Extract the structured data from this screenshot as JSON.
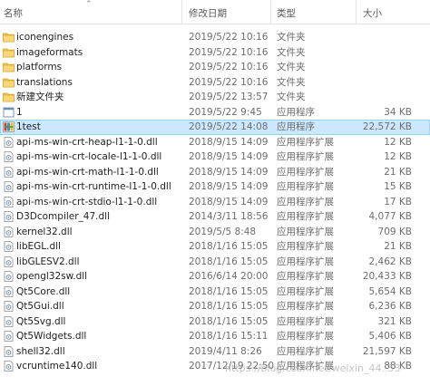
{
  "columns": {
    "name": "名称",
    "modified": "修改日期",
    "type": "类型",
    "size": "大小"
  },
  "files": [
    {
      "name": "iconengines",
      "modified": "2019/5/22 10:16",
      "type": "文件夹",
      "size": "",
      "icon": "folder-icon"
    },
    {
      "name": "imageformats",
      "modified": "2019/5/22 10:16",
      "type": "文件夹",
      "size": "",
      "icon": "folder-icon"
    },
    {
      "name": "platforms",
      "modified": "2019/5/22 10:16",
      "type": "文件夹",
      "size": "",
      "icon": "folder-icon"
    },
    {
      "name": "translations",
      "modified": "2019/5/22 10:16",
      "type": "文件夹",
      "size": "",
      "icon": "folder-icon"
    },
    {
      "name": "新建文件夹",
      "modified": "2019/5/22 13:57",
      "type": "文件夹",
      "size": "",
      "icon": "folder-icon"
    },
    {
      "name": "1",
      "modified": "2019/5/22 9:45",
      "type": "应用程序",
      "size": "34 KB",
      "icon": "app-icon"
    },
    {
      "name": "1test",
      "modified": "2019/5/22 14:08",
      "type": "应用程序",
      "size": "22,572 KB",
      "icon": "qt-app-icon",
      "selected": true
    },
    {
      "name": "api-ms-win-crt-heap-l1-1-0.dll",
      "modified": "2018/9/15 14:09",
      "type": "应用程序扩展",
      "size": "12 KB",
      "icon": "dll-icon"
    },
    {
      "name": "api-ms-win-crt-locale-l1-1-0.dll",
      "modified": "2018/9/15 14:09",
      "type": "应用程序扩展",
      "size": "12 KB",
      "icon": "dll-icon"
    },
    {
      "name": "api-ms-win-crt-math-l1-1-0.dll",
      "modified": "2018/9/15 14:09",
      "type": "应用程序扩展",
      "size": "21 KB",
      "icon": "dll-icon"
    },
    {
      "name": "api-ms-win-crt-runtime-l1-1-0.dll",
      "modified": "2018/9/15 14:09",
      "type": "应用程序扩展",
      "size": "15 KB",
      "icon": "dll-icon"
    },
    {
      "name": "api-ms-win-crt-stdio-l1-1-0.dll",
      "modified": "2018/9/15 14:09",
      "type": "应用程序扩展",
      "size": "17 KB",
      "icon": "dll-icon"
    },
    {
      "name": "D3Dcompiler_47.dll",
      "modified": "2014/3/11 18:56",
      "type": "应用程序扩展",
      "size": "4,077 KB",
      "icon": "dll-icon"
    },
    {
      "name": "kernel32.dll",
      "modified": "2019/5/5 8:48",
      "type": "应用程序扩展",
      "size": "709 KB",
      "icon": "dll-icon"
    },
    {
      "name": "libEGL.dll",
      "modified": "2018/1/16 15:05",
      "type": "应用程序扩展",
      "size": "21 KB",
      "icon": "dll-icon"
    },
    {
      "name": "libGLESV2.dll",
      "modified": "2018/1/16 15:05",
      "type": "应用程序扩展",
      "size": "2,462 KB",
      "icon": "dll-icon"
    },
    {
      "name": "opengl32sw.dll",
      "modified": "2016/6/14 20:00",
      "type": "应用程序扩展",
      "size": "20,433 KB",
      "icon": "dll-icon"
    },
    {
      "name": "Qt5Core.dll",
      "modified": "2018/1/16 15:05",
      "type": "应用程序扩展",
      "size": "5,654 KB",
      "icon": "dll-icon"
    },
    {
      "name": "Qt5Gui.dll",
      "modified": "2018/1/16 15:05",
      "type": "应用程序扩展",
      "size": "6,236 KB",
      "icon": "dll-icon"
    },
    {
      "name": "Qt5Svg.dll",
      "modified": "2018/1/16 15:05",
      "type": "应用程序扩展",
      "size": "321 KB",
      "icon": "dll-icon"
    },
    {
      "name": "Qt5Widgets.dll",
      "modified": "2018/1/16 15:11",
      "type": "应用程序扩展",
      "size": "5,406 KB",
      "icon": "dll-icon"
    },
    {
      "name": "shell32.dll",
      "modified": "2019/4/11 8:26",
      "type": "应用程序扩展",
      "size": "21,597 KB",
      "icon": "dll-icon"
    },
    {
      "name": "vcruntime140.dll",
      "modified": "2017/12/19 22:50",
      "type": "应用程序扩展",
      "size": "88 KB",
      "icon": "dll-icon"
    }
  ],
  "watermark": "https://blog.csdn.net/weixin_44..53",
  "colors": {
    "folder": "#e8b544",
    "selection": "#cce8ff",
    "selection_border": "#99d1ff"
  }
}
